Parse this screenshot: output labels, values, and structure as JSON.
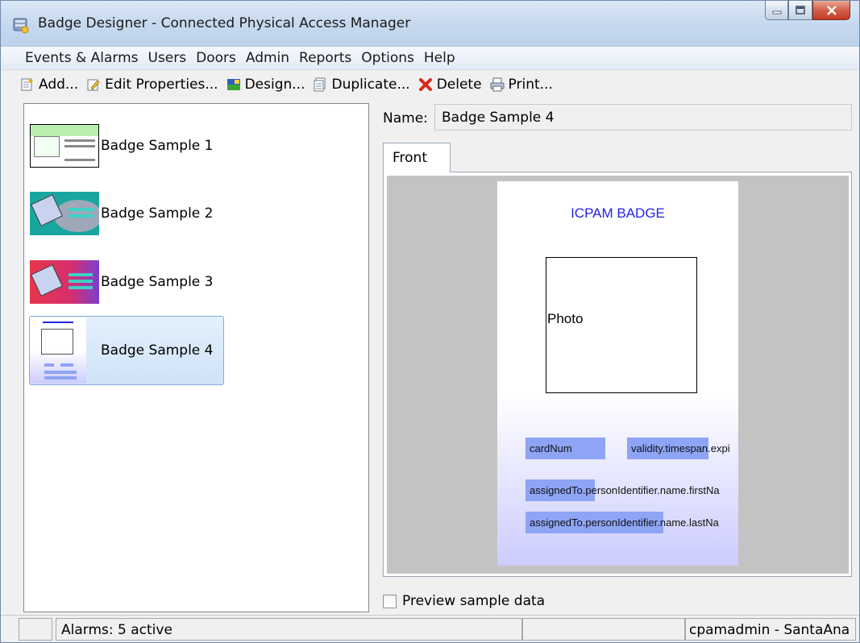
{
  "window": {
    "title": "Badge Designer - Connected Physical Access Manager"
  },
  "menu": [
    "Events & Alarms",
    "Users",
    "Doors",
    "Admin",
    "Reports",
    "Options",
    "Help"
  ],
  "toolbar": {
    "add": "Add...",
    "edit": "Edit Properties...",
    "design": "Design...",
    "duplicate": "Duplicate...",
    "delete": "Delete",
    "print": "Print..."
  },
  "badges": [
    {
      "label": "Badge Sample 1",
      "thumb_color": "#c8f0c0"
    },
    {
      "label": "Badge Sample 2",
      "thumb_color": "#1aa6a0"
    },
    {
      "label": "Badge Sample 3",
      "thumb_color": "#e8344a"
    },
    {
      "label": "Badge Sample 4",
      "thumb_color": "#ffffff",
      "selected": true
    }
  ],
  "details": {
    "name_label": "Name:",
    "name_value": "Badge Sample 4",
    "tab_front": "Front"
  },
  "card": {
    "title": "ICPAM BADGE",
    "photo_label": "Photo",
    "fields": [
      "cardNum",
      "validity.timespan.expi",
      "assignedTo.personIdentifier.name.firstNa",
      "assignedTo.personIdentifier.name.lastNa"
    ],
    "title_color": "#2323e6",
    "field_color": "#8ea4f5"
  },
  "preview": {
    "label": "Preview sample data",
    "checked": false
  },
  "status": {
    "alarms": "Alarms: 5 active",
    "user": "cpamadmin - SantaAna"
  }
}
